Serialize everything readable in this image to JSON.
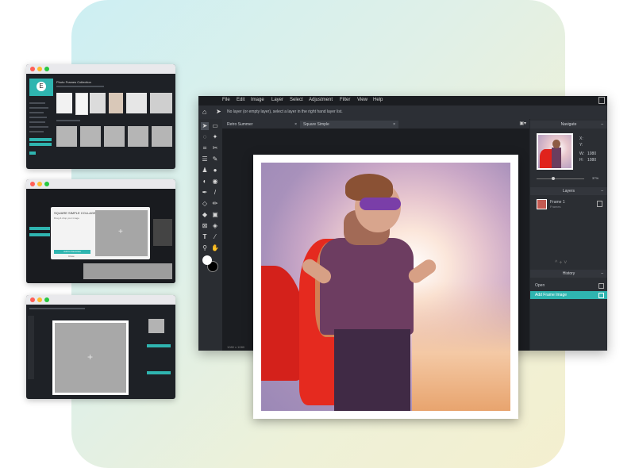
{
  "editor": {
    "menu": [
      "File",
      "Edit",
      "Image",
      "Layer",
      "Select",
      "Adjustment",
      "Filter",
      "View",
      "Help"
    ],
    "info_text": "No layer (or empty layer), select a layer in the right hand layer list.",
    "tabs": [
      {
        "label": "Retro Summer"
      },
      {
        "label": "Square Simple"
      }
    ],
    "status_text": "1080 x 1080",
    "navigate": {
      "title": "Navigate",
      "x_label": "X:",
      "y_label": "Y:",
      "w_label": "W:",
      "w_value": "1080",
      "h_label": "H:",
      "h_value": "1080",
      "zoom": "37%"
    },
    "layers": {
      "title": "Layers",
      "items": [
        {
          "name": "Frame 1",
          "sub": "Frames"
        }
      ]
    },
    "history": {
      "title": "History",
      "items": [
        {
          "label": "Open"
        },
        {
          "label": "Add Frame Image"
        }
      ]
    }
  },
  "mini1": {
    "title": "Photo Frames Collection"
  },
  "mini2": {
    "dialog_title": "SQUARE SIMPLE COLLAGE",
    "dialog_text": "Drag & drop your image",
    "dialog_button": "Add to Favorites",
    "dialog_link": "Close"
  },
  "colors": {
    "accent": "#2fb5b0",
    "dark": "#25282d"
  }
}
